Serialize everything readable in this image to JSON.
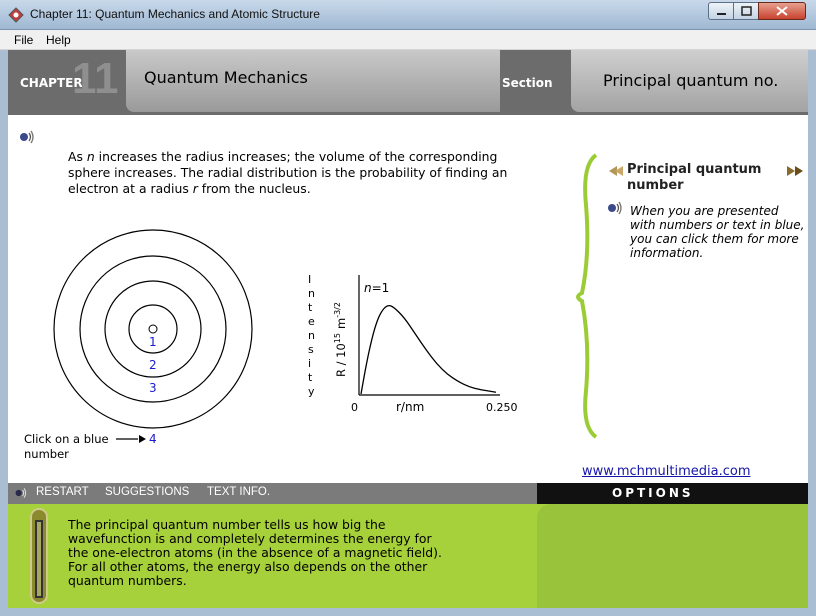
{
  "window": {
    "title": "Chapter 11:  Quantum Mechanics and Atomic Structure"
  },
  "menu": {
    "items": [
      "File",
      "Help"
    ]
  },
  "header": {
    "chapter_label": "CHAPTER",
    "chapter_number": "11",
    "title": "Quantum Mechanics",
    "section_label": "Section",
    "section_value": "Principal quantum no."
  },
  "intro": {
    "line1_pre": "As ",
    "n": "n",
    "line1_post": " increases the radius increases; the volume of the corresponding sphere increases. The radial distribution is the probability of finding an electron at a radius ",
    "r": "r",
    "line_end": " from the nucleus."
  },
  "orbit_diagram": {
    "labels": [
      "1",
      "2",
      "3",
      "4"
    ],
    "hint_line1": "Click on a blue",
    "hint_line2": "number"
  },
  "chart_data": {
    "type": "line",
    "ylabel_letters": [
      "I",
      "n",
      "t",
      "e",
      "n",
      "s",
      "i",
      "t",
      "y"
    ],
    "ylabel_axis": "R / 10",
    "ylabel_exp": "15",
    "ylabel_unit": "m",
    "ylabel_unit_exp": "-3/2",
    "xlabel": "r/nm",
    "x_min_label": "0",
    "x_max_label": "0.250",
    "annotation": "n=1",
    "xlim": [
      0,
      0.25
    ],
    "x": [
      0,
      0.01,
      0.02,
      0.03,
      0.04,
      0.05,
      0.06,
      0.08,
      0.1,
      0.12,
      0.14,
      0.16,
      0.18,
      0.2,
      0.22,
      0.25
    ],
    "y": [
      0,
      0.34,
      0.62,
      0.83,
      0.95,
      1.0,
      0.98,
      0.86,
      0.68,
      0.5,
      0.34,
      0.22,
      0.14,
      0.08,
      0.05,
      0.02
    ]
  },
  "info_panel": {
    "title": "Principal quantum number",
    "text": "When you are presented with numbers or text in blue, you can click them for more information."
  },
  "website": "www.mchmultimedia.com",
  "controls": {
    "restart": "RESTART",
    "suggestions": "SUGGESTIONS",
    "text_info": "TEXT INFO."
  },
  "options": {
    "label": "OPTIONS"
  },
  "bottom_text": "The principal quantum number tells us how big the wavefunction is and completely determines the energy for the one-electron atoms (in the absence of a magnetic field).  For all other atoms, the energy also depends on the other quantum numbers.",
  "colors": {
    "header": "#6c6c6c",
    "panel_green": "#a7d13a",
    "link_blue": "#1515a8",
    "bracket_green": "#9ccc35"
  }
}
